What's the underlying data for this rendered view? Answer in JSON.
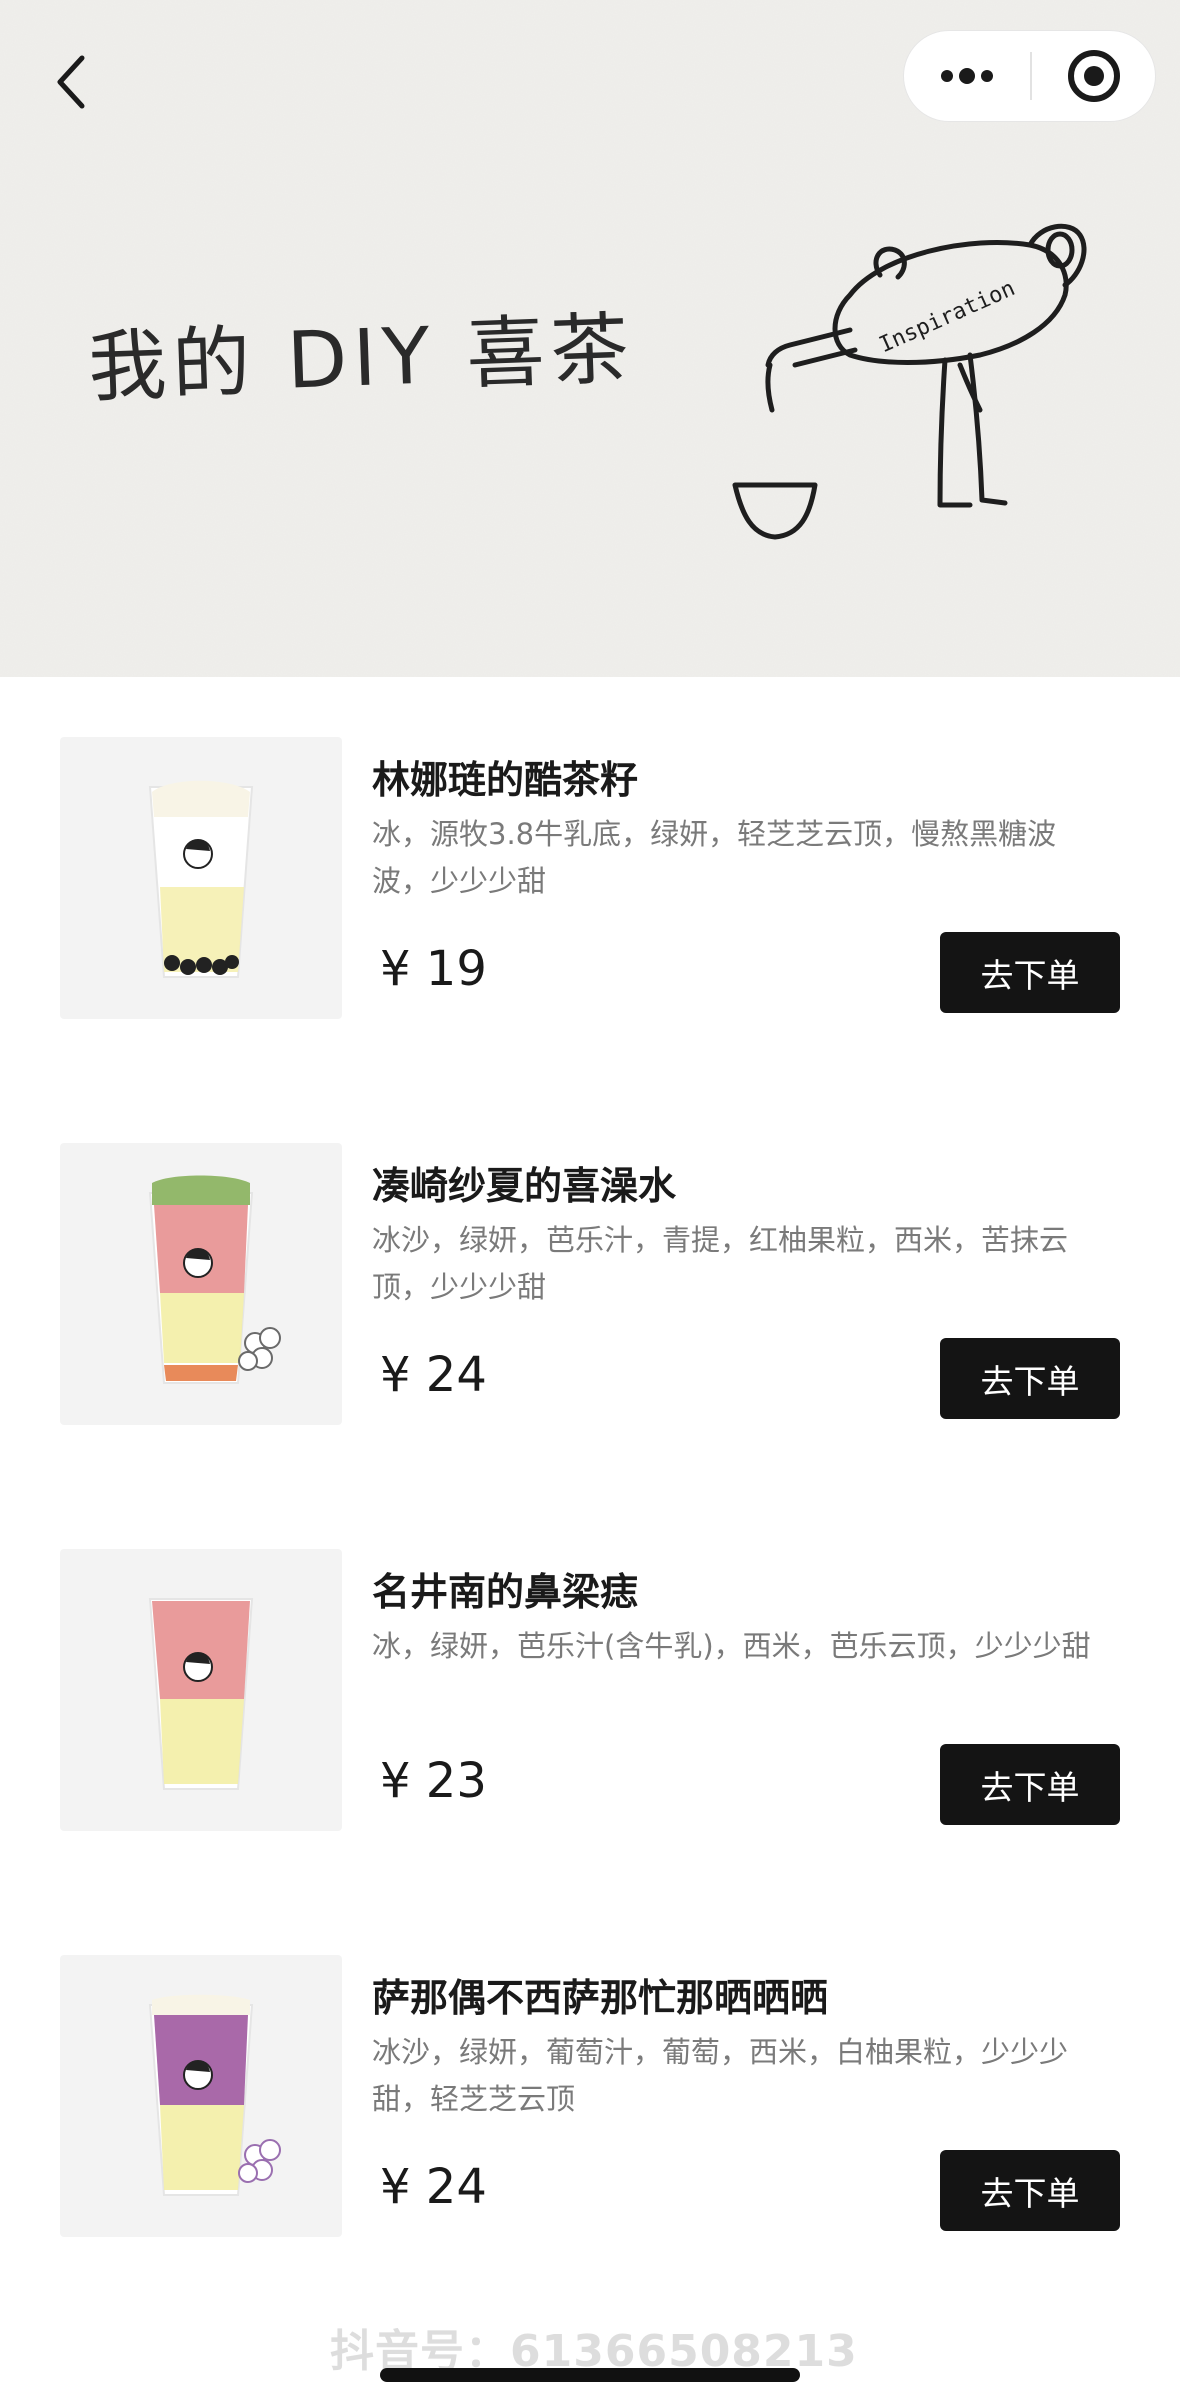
{
  "header": {
    "title": "我的 DIY 喜茶",
    "art_label": "Inspiration"
  },
  "products": [
    {
      "name": "林娜琏的酷茶籽",
      "desc": "冰，源牧3.8牛乳底，绿妍，轻芝芝云顶，慢熬黑糖波波，少少少甜",
      "price": "¥ 19",
      "button": "去下单"
    },
    {
      "name": "凑崎纱夏的喜澡水",
      "desc": "冰沙，绿妍，芭乐汁，青提，红柚果粒，西米，苦抹云顶，少少少甜",
      "price": "¥ 24",
      "button": "去下单"
    },
    {
      "name": "名井南的鼻梁痣",
      "desc": "冰，绿妍，芭乐汁(含牛乳)，西米，芭乐云顶，少少少甜",
      "price": "¥ 23",
      "button": "去下单"
    },
    {
      "name": "萨那偶不西萨那忙那晒晒晒",
      "desc": "冰沙，绿妍，葡萄汁，葡萄，西米，白柚果粒，少少少甜，轻芝芝云顶",
      "price": "¥ 24",
      "button": "去下单"
    }
  ],
  "watermark": "抖音号：61366508213",
  "icons": {
    "back": "chevron-left-icon",
    "more": "more-dots-icon",
    "close": "target-close-icon"
  }
}
